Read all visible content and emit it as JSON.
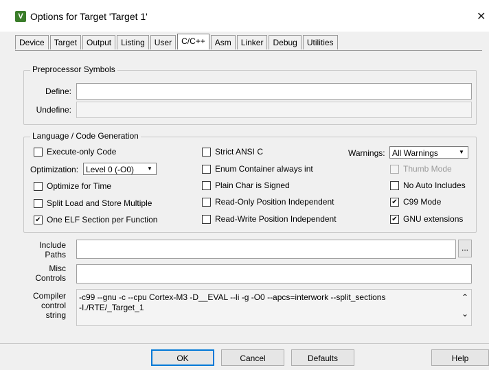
{
  "window": {
    "title": "Options for Target 'Target 1'",
    "icon": "uvision-app-icon",
    "close_glyph": "✕"
  },
  "tabs": [
    {
      "label": "Device",
      "active": false
    },
    {
      "label": "Target",
      "active": false
    },
    {
      "label": "Output",
      "active": false
    },
    {
      "label": "Listing",
      "active": false
    },
    {
      "label": "User",
      "active": false
    },
    {
      "label": "C/C++",
      "active": true
    },
    {
      "label": "Asm",
      "active": false
    },
    {
      "label": "Linker",
      "active": false
    },
    {
      "label": "Debug",
      "active": false
    },
    {
      "label": "Utilities",
      "active": false
    }
  ],
  "preprocessor": {
    "legend": "Preprocessor Symbols",
    "define_label": "Define:",
    "define_value": "",
    "undefine_label": "Undefine:",
    "undefine_value": ""
  },
  "language": {
    "legend": "Language / Code Generation",
    "execute_only": {
      "label": "Execute-only Code",
      "checked": false
    },
    "optimization_label": "Optimization:",
    "optimization_value": "Level 0 (-O0)",
    "optimize_time": {
      "label": "Optimize for Time",
      "checked": false
    },
    "split_load": {
      "label": "Split Load and Store Multiple",
      "checked": false
    },
    "one_elf": {
      "label": "One ELF Section per Function",
      "checked": true
    },
    "strict_ansi": {
      "label": "Strict ANSI C",
      "checked": false
    },
    "enum_container": {
      "label": "Enum Container always int",
      "checked": false
    },
    "plain_char": {
      "label": "Plain Char is Signed",
      "checked": false
    },
    "ro_position": {
      "label": "Read-Only Position Independent",
      "checked": false
    },
    "rw_position": {
      "label": "Read-Write Position Independent",
      "checked": false
    },
    "warnings_label": "Warnings:",
    "warnings_value": "All Warnings",
    "thumb_mode": {
      "label": "Thumb Mode",
      "checked": false,
      "disabled": true
    },
    "no_auto_includes": {
      "label": "No Auto Includes",
      "checked": false
    },
    "c99_mode": {
      "label": "C99 Mode",
      "checked": true
    },
    "gnu_extensions": {
      "label": "GNU extensions",
      "checked": true
    }
  },
  "include_paths": {
    "label_line1": "Include",
    "label_line2": "Paths",
    "value": "",
    "browse": "..."
  },
  "misc_controls": {
    "label_line1": "Misc",
    "label_line2": "Controls",
    "value": ""
  },
  "compiler_control": {
    "label_line1": "Compiler",
    "label_line2": "control",
    "label_line3": "string",
    "line1": "-c99 --gnu -c --cpu Cortex-M3 -D__EVAL --li -g -O0 --apcs=interwork --split_sections",
    "line2": "-I./RTE/_Target_1"
  },
  "buttons": {
    "ok": "OK",
    "cancel": "Cancel",
    "defaults": "Defaults",
    "help": "Help"
  },
  "check_glyph": "✔",
  "scroll_up": "⌃",
  "scroll_down": "⌄",
  "dropdown_glyph": "▼"
}
